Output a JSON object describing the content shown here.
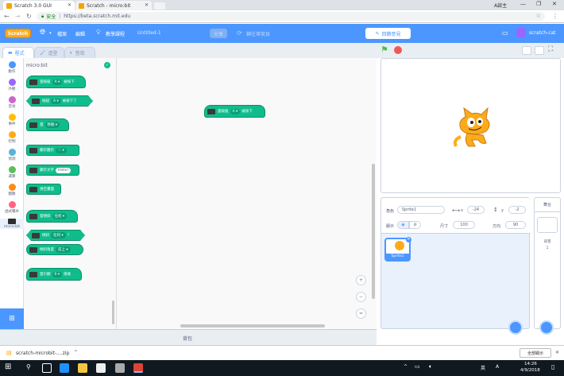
{
  "browser": {
    "tabs": [
      {
        "label": "Scratch 3.0 GUI"
      },
      {
        "label": "Scratch - micro:bit"
      }
    ],
    "window_user": "A啟主",
    "secure_label": "安全",
    "url": "https://beta.scratch.mit.edu"
  },
  "menu": {
    "logo": "Scratch",
    "file": "檔案",
    "edit": "編輯",
    "tutorials": "教學課程",
    "project_title": "Untitled-1",
    "share": "分享",
    "see_project": "轉往專案頁",
    "remix": "回饋意見",
    "user": "scratch-cat"
  },
  "editor_tabs": {
    "code": "程式",
    "costumes": "造型",
    "sounds": "音效"
  },
  "categories": [
    {
      "label": "動作",
      "color": "#4c97ff"
    },
    {
      "label": "外觀",
      "color": "#9966ff"
    },
    {
      "label": "音效",
      "color": "#cf63cf"
    },
    {
      "label": "事件",
      "color": "#ffbf00"
    },
    {
      "label": "控制",
      "color": "#ffab19"
    },
    {
      "label": "偵測",
      "color": "#5cb1d6"
    },
    {
      "label": "運算",
      "color": "#59c059"
    },
    {
      "label": "變數",
      "color": "#ff8c1a"
    },
    {
      "label": "函式積木",
      "color": "#ff6680"
    },
    {
      "label": "micro:bit",
      "color": "#2e2e2e"
    }
  ],
  "palette": {
    "heading": "micro:bit",
    "blocks": {
      "when_button": {
        "text1": "當按鈕",
        "dd": "A ▾",
        "text2": "被按下"
      },
      "button_pressed": {
        "text1": "按鈕",
        "dd": "A ▾",
        "text2": "被按下了"
      },
      "when_moved": {
        "text1": "當",
        "dd": "移動 ▾"
      },
      "display_icon": {
        "text1": "顯示圖示",
        "icon": "♡ ▾"
      },
      "display_text": {
        "text1": "顯示文字",
        "pill": "Hello!"
      },
      "clear_display": {
        "text1": "清空畫面"
      },
      "when_tilted": {
        "text1": "當傾斜",
        "dd": "任何 ▾"
      },
      "tilted": {
        "text1": "傾斜",
        "dd": "任何 ▾",
        "text2": "?"
      },
      "tilt_angle": {
        "text1": "傾斜角度",
        "dd": "前上 ▾"
      },
      "when_pin": {
        "text1": "當引腳",
        "dd": "0 ▾",
        "text2": "接收"
      }
    }
  },
  "workspace_block": {
    "text1": "當按鈕",
    "dd": "A ▾",
    "text2": "被按下"
  },
  "zoom": {
    "in": "+",
    "out": "−",
    "reset": "="
  },
  "backpack_label": "背包",
  "sprite_info": {
    "sprite_label": "角色",
    "sprite_name": "Sprite1",
    "x_label": "x",
    "x_value": "-24",
    "y_label": "y",
    "y_value": "-2",
    "show_label": "顯示",
    "size_label": "尺寸",
    "size_value": "100",
    "direction_label": "方向",
    "direction_value": "90"
  },
  "sprite_tile": {
    "name": "Sprite1"
  },
  "stage_panel": {
    "title": "舞台",
    "backdrops_label": "背景",
    "backdrops_count": "1"
  },
  "download": {
    "file": "scratch-microbit-....zip",
    "show_all": "全部顯示"
  },
  "taskbar": {
    "time": "14:26",
    "date": "4/9/2018",
    "lang": "英",
    "ime": "A"
  },
  "colors": {
    "scratch_blue": "#4c97ff",
    "microbit_block": "#0fbd8c"
  }
}
